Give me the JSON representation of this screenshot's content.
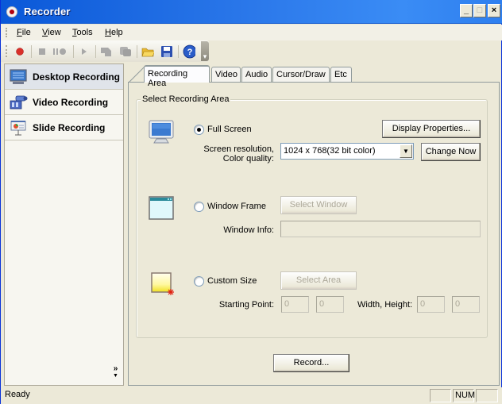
{
  "window": {
    "title": "Recorder",
    "app_icon": "record-icon"
  },
  "title_buttons": {
    "minimize": "_",
    "maximize": "□",
    "close": "×"
  },
  "menu": [
    {
      "label": "File",
      "accel": "F",
      "rest": "ile"
    },
    {
      "label": "View",
      "accel": "V",
      "rest": "iew"
    },
    {
      "label": "Tools",
      "accel": "T",
      "rest": "ools"
    },
    {
      "label": "Help",
      "accel": "H",
      "rest": "elp"
    }
  ],
  "toolbar": {
    "items": [
      "record",
      "stop",
      "pause-record",
      "play",
      "export",
      "convert",
      "open-folder",
      "save",
      "help"
    ],
    "chevron": "▾"
  },
  "sidebar": {
    "items": [
      {
        "label": "Desktop Recording",
        "icon": "monitor-icon",
        "active": true
      },
      {
        "label": "Video Recording",
        "icon": "video-camera-icon",
        "active": false
      },
      {
        "label": "Slide Recording",
        "icon": "slide-presentation-icon",
        "active": false
      }
    ],
    "more": "»"
  },
  "tabs": [
    {
      "label": "Recording Area",
      "active": true
    },
    {
      "label": "Video",
      "active": false
    },
    {
      "label": "Audio",
      "active": false
    },
    {
      "label": "Cursor/Draw",
      "active": false
    },
    {
      "label": "Etc",
      "active": false
    }
  ],
  "group": {
    "title": "Select Recording Area",
    "full_screen": {
      "label": "Full Screen",
      "checked": true,
      "display_properties_button": "Display Properties...",
      "resolution_label_line1": "Screen resolution,",
      "resolution_label_line2": "Color quality:",
      "resolution_value": "1024 x 768(32 bit color)",
      "change_now_button": "Change Now"
    },
    "window_frame": {
      "label": "Window Frame",
      "checked": false,
      "select_window_button": "Select Window",
      "window_info_label": "Window Info:",
      "window_info_value": ""
    },
    "custom_size": {
      "label": "Custom Size",
      "checked": false,
      "select_area_button": "Select Area",
      "starting_point_label": "Starting Point:",
      "start_x": "0",
      "start_y": "0",
      "size_label": "Width, Height:",
      "width": "0",
      "height": "0"
    }
  },
  "record_button": "Record...",
  "status": {
    "text": "Ready",
    "panes": [
      "",
      "NUM",
      ""
    ]
  }
}
